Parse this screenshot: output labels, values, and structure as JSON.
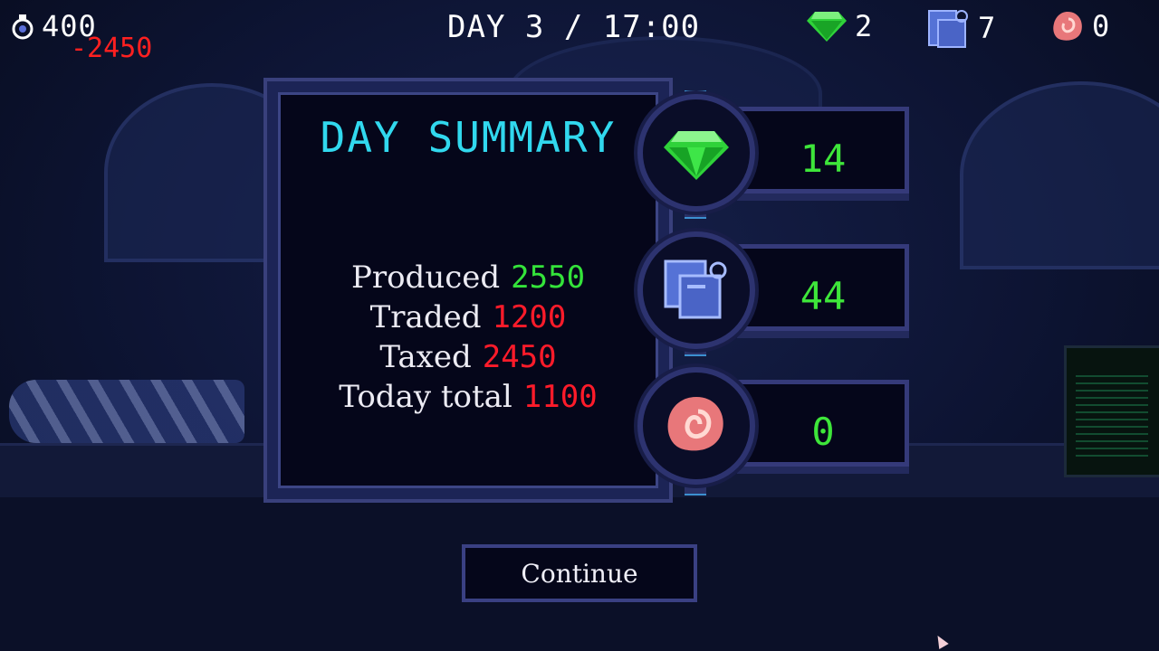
{
  "hud": {
    "money": "400",
    "money_delta": "-2450",
    "day_time": "DAY 3 / 17:00",
    "gems": "2",
    "documents": "7",
    "shells": "0"
  },
  "summary": {
    "title": "DAY SUMMARY",
    "rows": [
      {
        "label": "Produced",
        "value": "2550",
        "color": "#34e33a"
      },
      {
        "label": "Traded",
        "value": "1200",
        "color": "#ff1b2a"
      },
      {
        "label": "Taxed",
        "value": "2450",
        "color": "#ff1b2a"
      },
      {
        "label": "Today total",
        "value": "1100",
        "color": "#ff1b2a"
      }
    ]
  },
  "resources": [
    {
      "icon": "gem-icon",
      "count": "14"
    },
    {
      "icon": "documents-icon",
      "count": "44"
    },
    {
      "icon": "shell-icon",
      "count": "0"
    }
  ],
  "continue_label": "Continue",
  "colors": {
    "title": "#31d8ee",
    "positive": "#34e33a",
    "negative": "#ff1b2a",
    "panel_border": "#39407c"
  }
}
